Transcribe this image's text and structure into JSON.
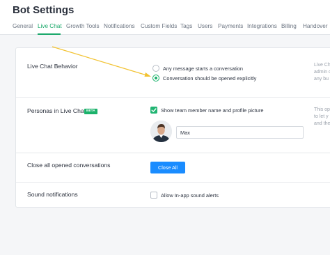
{
  "page": {
    "title": "Bot Settings"
  },
  "tabs": [
    {
      "label": "General"
    },
    {
      "label": "Live Chat"
    },
    {
      "label": "Growth Tools"
    },
    {
      "label": "Notifications"
    },
    {
      "label": "Custom Fields"
    },
    {
      "label": "Tags"
    },
    {
      "label": "Users"
    },
    {
      "label": "Payments"
    },
    {
      "label": "Integrations"
    },
    {
      "label": "Billing"
    },
    {
      "label": "Handover"
    }
  ],
  "active_tab": "Live Chat",
  "live_chat_behavior": {
    "label": "Live Chat Behavior",
    "options": [
      {
        "label": "Any message starts a conversation",
        "selected": false
      },
      {
        "label": "Conversation should be opened explicitly",
        "selected": true
      }
    ],
    "help_lines": [
      "Live Ch",
      "admin c",
      "any bu"
    ]
  },
  "personas": {
    "label": "Personas in Live Chat",
    "badge": "BETA",
    "checkbox_label": "Show team member name and profile picture",
    "checked": true,
    "name_value": "Max",
    "help_lines": [
      "This op",
      "to let y",
      "and the"
    ]
  },
  "close_conversations": {
    "label": "Close all opened conversations",
    "button_label": "Close All"
  },
  "sound": {
    "label": "Sound notifications",
    "checkbox_label": "Allow In-app sound alerts",
    "checked": false
  },
  "colors": {
    "accent_green": "#1aa86a",
    "button_blue": "#1a8cff",
    "annotation_arrow": "#f2c230"
  }
}
